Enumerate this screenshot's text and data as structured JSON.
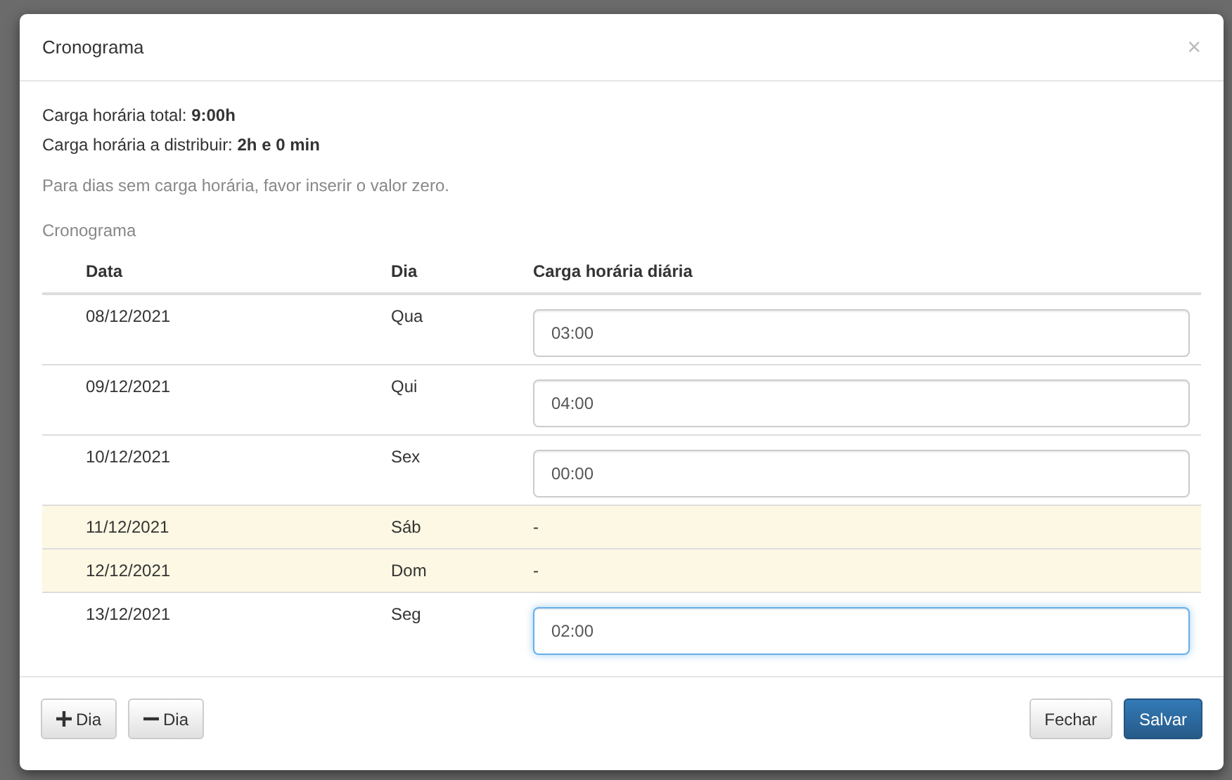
{
  "dialog": {
    "title": "Cronograma",
    "close": "×"
  },
  "summary": [
    {
      "label": "Carga horária total: ",
      "value": "9:00h"
    },
    {
      "label": "Carga horária a distribuir: ",
      "value": "2h e 0 min"
    }
  ],
  "hint": "Para dias sem carga horária, favor inserir o valor zero.",
  "section_label": "Cronograma",
  "table": {
    "columns": [
      "Data",
      "Dia",
      "Carga horária diária"
    ],
    "rows": [
      {
        "kind": "input",
        "date": "08/12/2021",
        "day": "Qua",
        "value": "03:00",
        "focused": false
      },
      {
        "kind": "input",
        "date": "09/12/2021",
        "day": "Qui",
        "value": "04:00",
        "focused": false
      },
      {
        "kind": "input",
        "date": "10/12/2021",
        "day": "Sex",
        "value": "00:00",
        "focused": false
      },
      {
        "kind": "blank",
        "date": "11/12/2021",
        "day": "Sáb",
        "value": "-"
      },
      {
        "kind": "blank",
        "date": "12/12/2021",
        "day": "Dom",
        "value": "-"
      },
      {
        "kind": "input",
        "date": "13/12/2021",
        "day": "Seg",
        "value": "02:00",
        "focused": true
      }
    ]
  },
  "footer": {
    "left_buttons": [
      {
        "kind": "add",
        "label": "Dia"
      },
      {
        "kind": "remove",
        "label": "Dia"
      }
    ],
    "right_buttons": [
      {
        "kind": "default",
        "label": "Fechar"
      },
      {
        "kind": "primary",
        "label": "Salvar"
      }
    ]
  }
}
